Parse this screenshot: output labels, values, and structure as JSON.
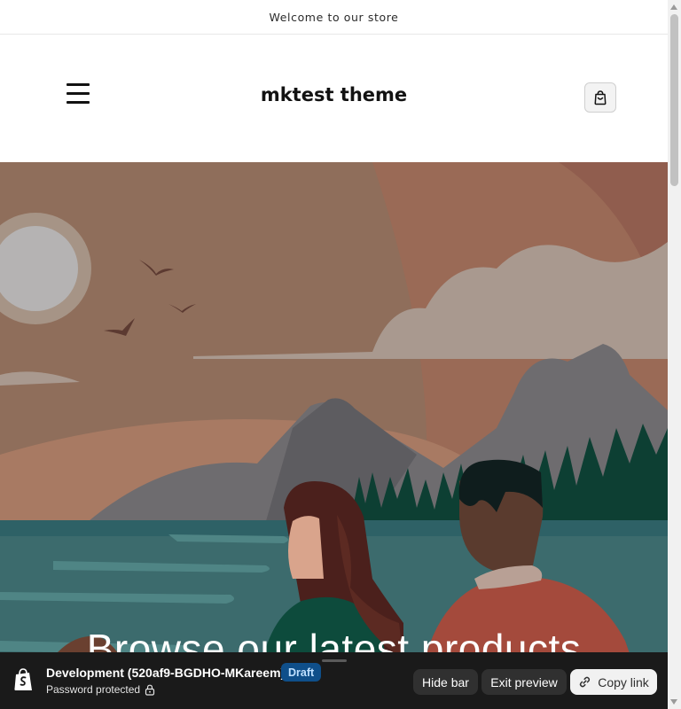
{
  "announcement": {
    "text": "Welcome to our store"
  },
  "header": {
    "store_name": "mktest theme",
    "menu_icon": "hamburger-menu-icon",
    "cart_icon": "shopping-bag-icon"
  },
  "hero": {
    "heading": "Browse our latest products",
    "image": "illustration-couple-lake-mountains"
  },
  "preview_bar": {
    "theme_name": "Development (520af9-BGDHO-MKareem)",
    "badge": "Draft",
    "status": "Password protected",
    "logo_icon": "shopify-bag-icon",
    "lock_icon": "lock-icon",
    "buttons": {
      "hide": "Hide bar",
      "exit": "Exit preview",
      "copy": "Copy link"
    },
    "colors": {
      "bar_bg": "#1a1a1a",
      "badge_bg": "#0f4f8a",
      "badge_text": "#bfe0ff"
    }
  }
}
